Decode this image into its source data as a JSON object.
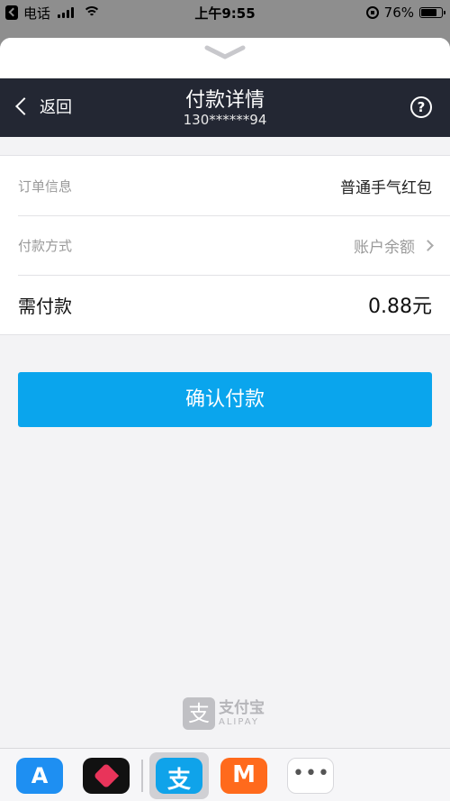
{
  "status_bar": {
    "carrier": "电话",
    "time": "上午9:55",
    "battery_text": "76%",
    "battery_level": 0.76,
    "icons": [
      "back-to-app-icon",
      "signal-icon",
      "wifi-icon",
      "rotation-lock-icon",
      "battery-icon"
    ]
  },
  "header": {
    "back_label": "返回",
    "title": "付款详情",
    "subtitle": "130******94",
    "help_symbol": "?"
  },
  "details": {
    "order_label": "订单信息",
    "order_value": "普通手气红包",
    "method_label": "付款方式",
    "method_value": "账户余额",
    "total_label": "需付款",
    "total_value": "0.88元"
  },
  "confirm_label": "确认付款",
  "footer": {
    "logo_mark": "支",
    "logo_cn": "支付宝",
    "logo_en": "ALIPAY"
  },
  "tray": {
    "apps": [
      "app-store-icon",
      "health-icon",
      "alipay-icon",
      "mgtv-icon",
      "more-icon"
    ],
    "app_store_glyph": "A",
    "alipay_glyph": "支",
    "mgtv_glyph": "M",
    "more_glyph": "•••"
  },
  "colors": {
    "navbar": "#232733",
    "confirm_button": "#0aa5ed",
    "background": "#f3f3f5"
  }
}
